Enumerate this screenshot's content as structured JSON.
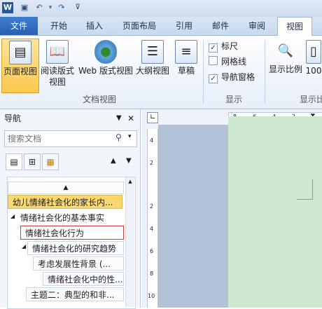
{
  "tabs": {
    "file": "文件",
    "home": "开始",
    "insert": "插入",
    "page_layout": "页面布局",
    "references": "引用",
    "mailings": "邮件",
    "review": "审阅",
    "view": "视图"
  },
  "ribbon": {
    "doc_views": {
      "page_view": "页面视图",
      "reading_view_line1": "阅读版式",
      "reading_view_line2": "视图",
      "web_view": "Web 版式视图",
      "outline_view": "大纲视图",
      "draft_view": "草稿",
      "group_label": "文档视图"
    },
    "show": {
      "ruler": "标尺",
      "gridlines": "网格线",
      "nav_pane": "导航窗格",
      "group_label": "显示"
    },
    "zoom": {
      "zoom_btn": "显示比例",
      "zoom_100": "100",
      "group_label": "显示比"
    }
  },
  "nav_pane": {
    "title": "导航",
    "search_placeholder": "搜索文档",
    "headings": [
      {
        "text": "幼儿情绪社会化的家长内..."
      },
      {
        "text": "情绪社会化的基本事实"
      },
      {
        "text": "情绪社会化行为"
      },
      {
        "text": "情绪社会化的研究趋势"
      },
      {
        "text": "考虑发展性背景 (..."
      },
      {
        "text": "情绪社会化中的性..."
      },
      {
        "text": "主题二：典型的和非..."
      }
    ]
  },
  "ruler": {
    "h_ticks": [
      "8",
      "6",
      "4",
      "2"
    ],
    "v_ticks": [
      "4",
      "2",
      "2",
      "4",
      "6",
      "8",
      "10"
    ]
  },
  "colors": {
    "accent": "#2a5fb0",
    "page_bg": "#cde8cf",
    "selected_heading": "#fbd873",
    "current_border": "#d23a3a"
  }
}
